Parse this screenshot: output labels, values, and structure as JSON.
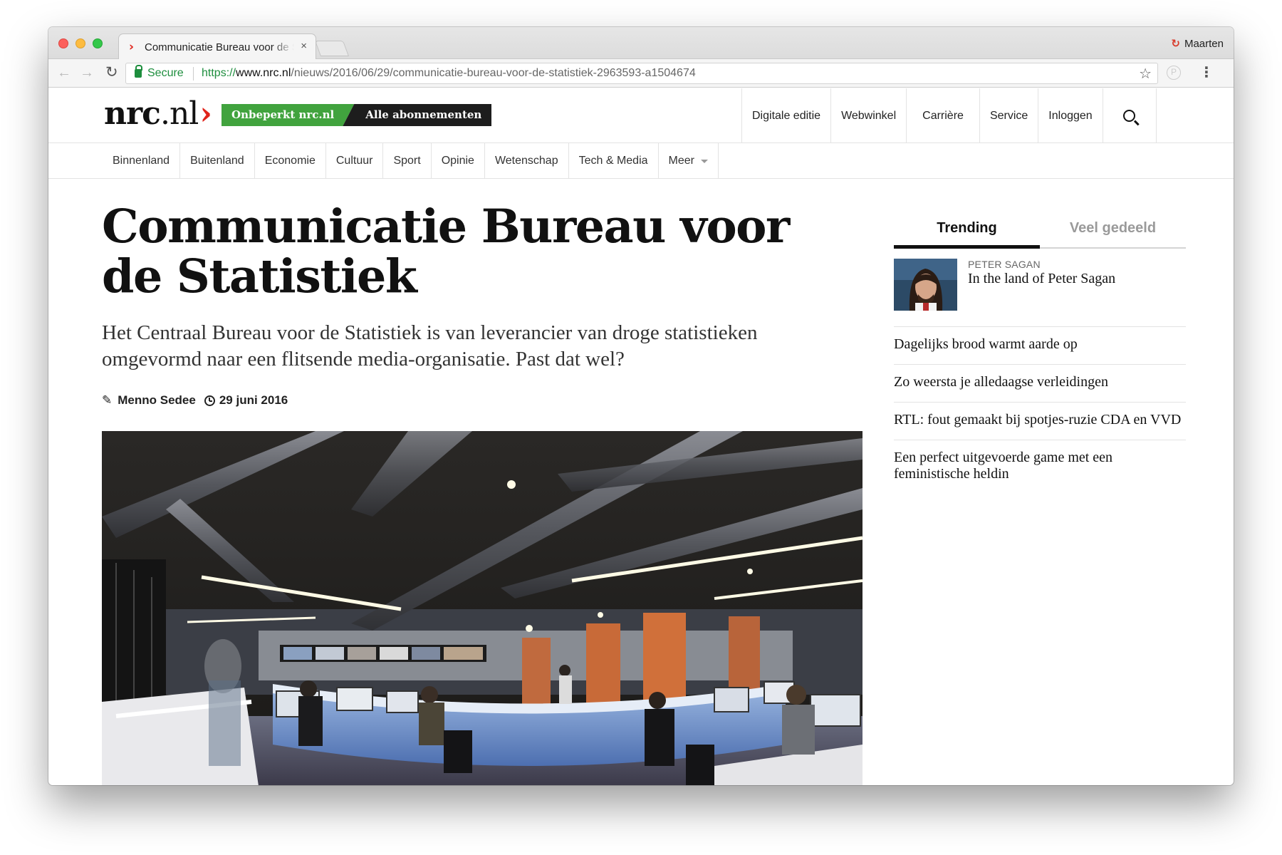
{
  "browser": {
    "tab_title": "Communicatie Bureau voor de Statistiek",
    "tab_favicon": "›",
    "tab_close": "×",
    "profile_name": "Maarten",
    "secure_label": "Secure",
    "url_proto": "https://",
    "url_host": "www.nrc.nl",
    "url_path": "/nieuws/2016/06/29/communicatie-bureau-voor-de-statistiek-2963593-a1504674"
  },
  "site": {
    "logo_bold": "nrc",
    "logo_light": ".nl",
    "logo_chevron": "›",
    "promo_primary": "Onbeperkt nrc.nl",
    "promo_secondary": "Alle abonnementen",
    "brand_red": "#e0241b",
    "brand_green": "#41a33e",
    "top_nav": [
      "Digitale editie",
      "Webwinkel",
      "Carrière",
      "Service",
      "Inloggen"
    ],
    "sections": [
      "Binnenland",
      "Buitenland",
      "Economie",
      "Cultuur",
      "Sport",
      "Opinie",
      "Wetenschap",
      "Tech & Media",
      "Meer"
    ]
  },
  "article": {
    "headline": "Communicatie Bureau voor de Statistiek",
    "lede": "Het Centraal Bureau voor de Statistiek is van leverancier van droge statistieken omgevormd naar een flitsende media-organisatie. Past dat wel?",
    "author": "Menno Sedee",
    "date": "29 juni 2016"
  },
  "sidebar": {
    "tabs": [
      "Trending",
      "Veel gedeeld"
    ],
    "feature": {
      "kicker": "PETER SAGAN",
      "title": "In the land of Peter Sagan"
    },
    "items": [
      "Dagelijks brood warmt aarde op",
      "Zo weersta je alledaagse verleidingen",
      "RTL: fout gemaakt bij spotjes-ruzie CDA en VVD",
      "Een perfect uitgevoerde game met een feministische heldin"
    ]
  }
}
